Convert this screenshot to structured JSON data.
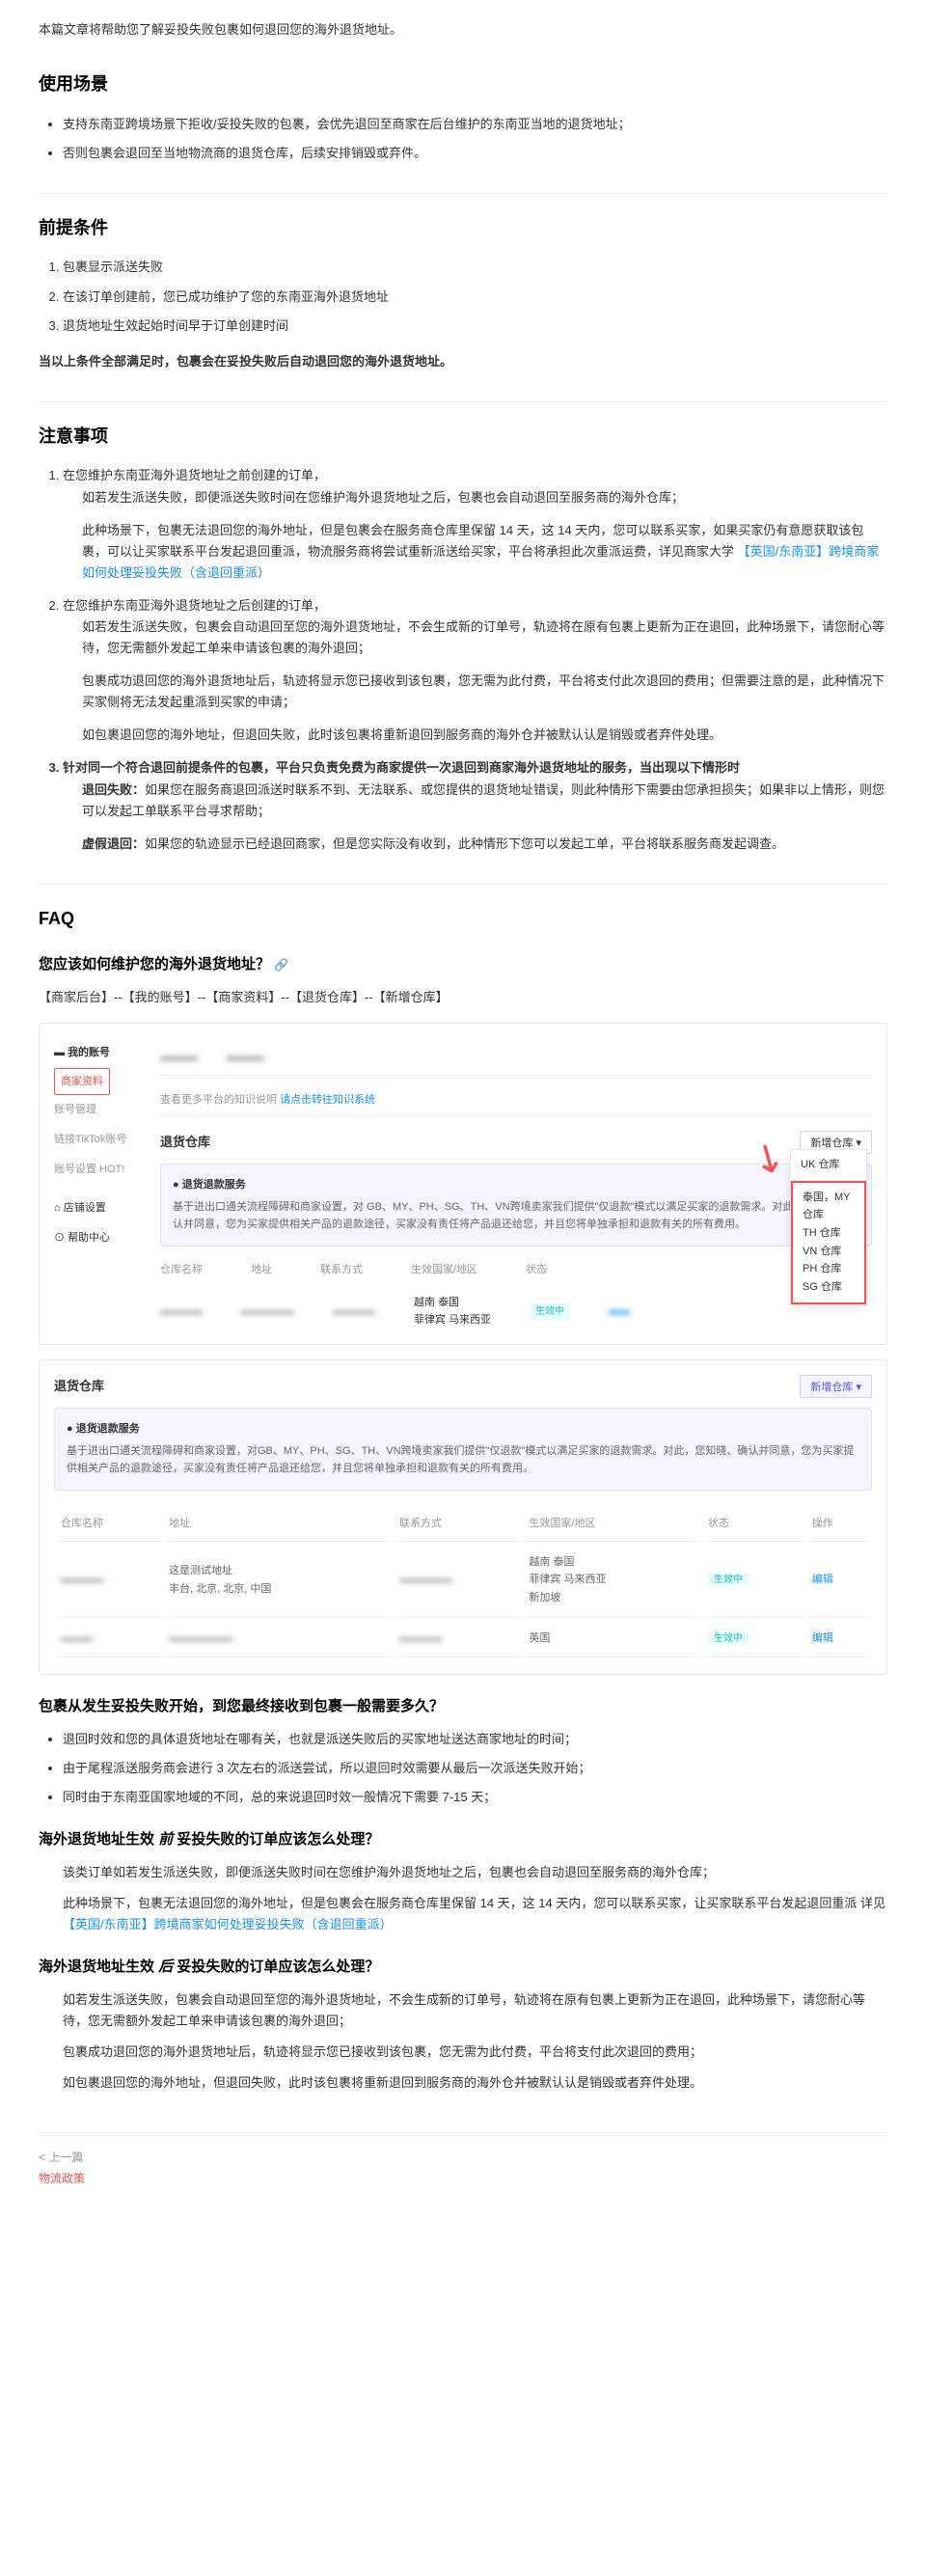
{
  "intro": "本篇文章将帮助您了解妥投失败包裹如何退回您的海外退货地址。",
  "sections": {
    "usage": {
      "title": "使用场景",
      "items": [
        "支持东南亚跨境场景下拒收/妥投失败的包裹，会优先退回至商家在后台维护的东南亚当地的退货地址；",
        "否则包裹会退回至当地物流商的退货仓库，后续安排销毁或弃件。"
      ]
    },
    "prereq": {
      "title": "前提条件",
      "items": [
        "包裹显示派送失败",
        "在该订单创建前，您已成功维护了您的东南亚海外退货地址",
        "退货地址生效起始时间早于订单创建时间"
      ],
      "summary": "当以上条件全部满足时，包裹会在妥投失败后自动退回您的海外退货地址。"
    },
    "notes": {
      "title": "注意事项",
      "item1_intro": "在您维护东南亚海外退货地址之前创建的订单，",
      "item1_p1": "如若发生派送失败，即便派送失败时间在您维护海外退货地址之后，包裹也会自动退回至服务商的海外仓库；",
      "item1_p2a": "此种场景下，包裹无法退回您的海外地址，但是包裹会在服务商仓库里保留 14 天，这 14 天内，您可以联系买家，如果买家仍有意愿获取该包裹，可以让买家联系平台发起退回重派，物流服务商将尝试重新派送给买家，平台将承担此次重派运费，详见商家大学 ",
      "item1_link": "【英国/东南亚】跨境商家如何处理妥投失败（含退回重派）",
      "item2_intro": "在您维护东南亚海外退货地址之后创建的订单，",
      "item2_p1": "如若发生派送失败，包裹会自动退回至您的海外退货地址，不会生成新的订单号，轨迹将在原有包裹上更新为正在退回，此种场景下，请您耐心等待，您无需额外发起工单来申请该包裹的海外退回；",
      "item2_p2": "包裹成功退回您的海外退货地址后，轨迹将显示您已接收到该包裹，您无需为此付费，平台将支付此次退回的费用；但需要注意的是，此种情况下买家侧将无法发起重派到买家的申请；",
      "item2_p3": "如包裹退回您的海外地址，但退回失败，此时该包裹将重新退回到服务商的海外仓并被默认认是销毁或者弃件处理。",
      "item3_intro": "针对同一个符合退回前提条件的包裹，平台只负责免费为商家提供一次退回到商家海外退货地址的服务，当出现以下情形时",
      "item3_fail_label": "退回失败：",
      "item3_fail": "如果您在服务商退回派送时联系不到、无法联系、或您提供的退货地址错误，则此种情形下需要由您承担损失；如果非以上情形，则您可以发起工单联系平台寻求帮助；",
      "item3_fake_label": "虚假退回：",
      "item3_fake": "如果您的轨迹显示已经退回商家，但是您实际没有收到，此种情形下您可以发起工单，平台将联系服务商发起调查。"
    },
    "faq": {
      "title": "FAQ",
      "q1": "您应该如何维护您的海外退货地址？",
      "q1_path": "【商家后台】--【我的账号】--【商家资料】--【退货仓库】--【新增仓库】",
      "q2": "包裹从发生妥投失败开始，到您最终接收到包裹一般需要多久？",
      "q2_items": [
        "退回时效和您的具体退货地址在哪有关，也就是派送失败后的买家地址送达商家地址的时间；",
        "由于尾程派送服务商会进行 3 次左右的派送尝试，所以退回时效需要从最后一次派送失败开始；",
        "同时由于东南亚国家地域的不同，总的来说退回时效一般情况下需要 7-15 天；"
      ],
      "q3_pre": "海外退货地址生效",
      "q3_em": "前",
      "q3_post": "妥投失败的订单应该怎么处理？",
      "q3_p1": "该类订单如若发生派送失败，即便派送失败时间在您维护海外退货地址之后，包裹也会自动退回至服务商的海外仓库；",
      "q3_p2a": "此种场景下，包裹无法退回您的海外地址，但是包裹会在服务商仓库里保留 14 天，这 14 天内，您可以联系买家，让买家联系平台发起退回重派 详见 ",
      "q3_link": "【英国/东南亚】跨境商家如何处理妥投失败（含退回重派）",
      "q4_pre": "海外退货地址生效",
      "q4_em": "后",
      "q4_post": "妥投失败的订单应该怎么处理？",
      "q4_p1": "如若发生派送失败，包裹会自动退回至您的海外退货地址，不会生成新的订单号，轨迹将在原有包裹上更新为正在退回，此种场景下，请您耐心等待，您无需额外发起工单来申请该包裹的海外退回；",
      "q4_p2": "包裹成功退回您的海外退货地址后，轨迹将显示您已接收到该包裹，您无需为此付费，平台将支付此次退回的费用；",
      "q4_p3": "如包裹退回您的海外地址，但退回失败，此时该包裹将重新退回到服务商的海外仓并被默认认是销毁或者弃件处理。"
    }
  },
  "screenshot1": {
    "sidebar_header": "我的账号",
    "sidebar": [
      "商家资料",
      "账号管理",
      "链接TikTok账号",
      "账号设置 HOT!"
    ],
    "sidebar_shop": "店铺设置",
    "sidebar_help": "帮助中心",
    "search_hint": "查看更多平台的知识说明",
    "search_link": "请点击转往知识系统",
    "section_title": "退货仓库",
    "btn_new": "新增仓库",
    "notice_title": "退货退款服务",
    "notice_body": "基于进出口通关流程障碍和商家设置，对 GB、MY、PH、SG、TH、VN跨境卖家我们提供\"仅退款\"模式以满足买家的退款需求。对此，您知晓，确认并同意，您为买家提供相关产品的退款途径，买家没有责任将产品退还给您，并且您将单独承担和退款有关的所有费用。",
    "dropdown": [
      "UK 仓库",
      "泰国，MY 仓库",
      "TH 仓库",
      "VN 仓库",
      "PH 仓库",
      "SG 仓库"
    ],
    "row_labels": [
      "仓库名称",
      "地址",
      "联系方式",
      "生效国家/地区",
      "状态"
    ],
    "row_tags": [
      "越南",
      "泰国",
      "马来西亚"
    ],
    "status": "生效中",
    "tag_extra": "菲律宾"
  },
  "screenshot2": {
    "title": "退货仓库",
    "btn_new": "新增仓库",
    "notice_title": "退货退款服务",
    "notice_body": "基于进出口通关流程障碍和商家设置，对GB、MY、PH、SG、TH、VN跨境卖家我们提供\"仅退款\"模式以满足买家的退款需求。对此，您知晓、确认并同意，您为买家提供相关产品的退款途径，买家没有责任将产品退还给您，并且您将单独承担和退款有关的所有费用。",
    "headers": [
      "仓库名称",
      "地址",
      "联系方式",
      "生效国家/地区",
      "状态",
      "操作"
    ],
    "row1": {
      "addr1": "这是测试地址",
      "addr2": "丰台, 北京, 北京, 中国",
      "tags": [
        "越南",
        "泰国",
        "菲律宾",
        "马来西亚",
        "新加坡"
      ],
      "status": "生效中",
      "action": "编辑"
    },
    "row2": {
      "tags": [
        "英国"
      ],
      "status": "生效中",
      "action": "编辑"
    }
  },
  "footer": {
    "prev_label": "< 上一篇",
    "prev_title": "物流政策"
  }
}
